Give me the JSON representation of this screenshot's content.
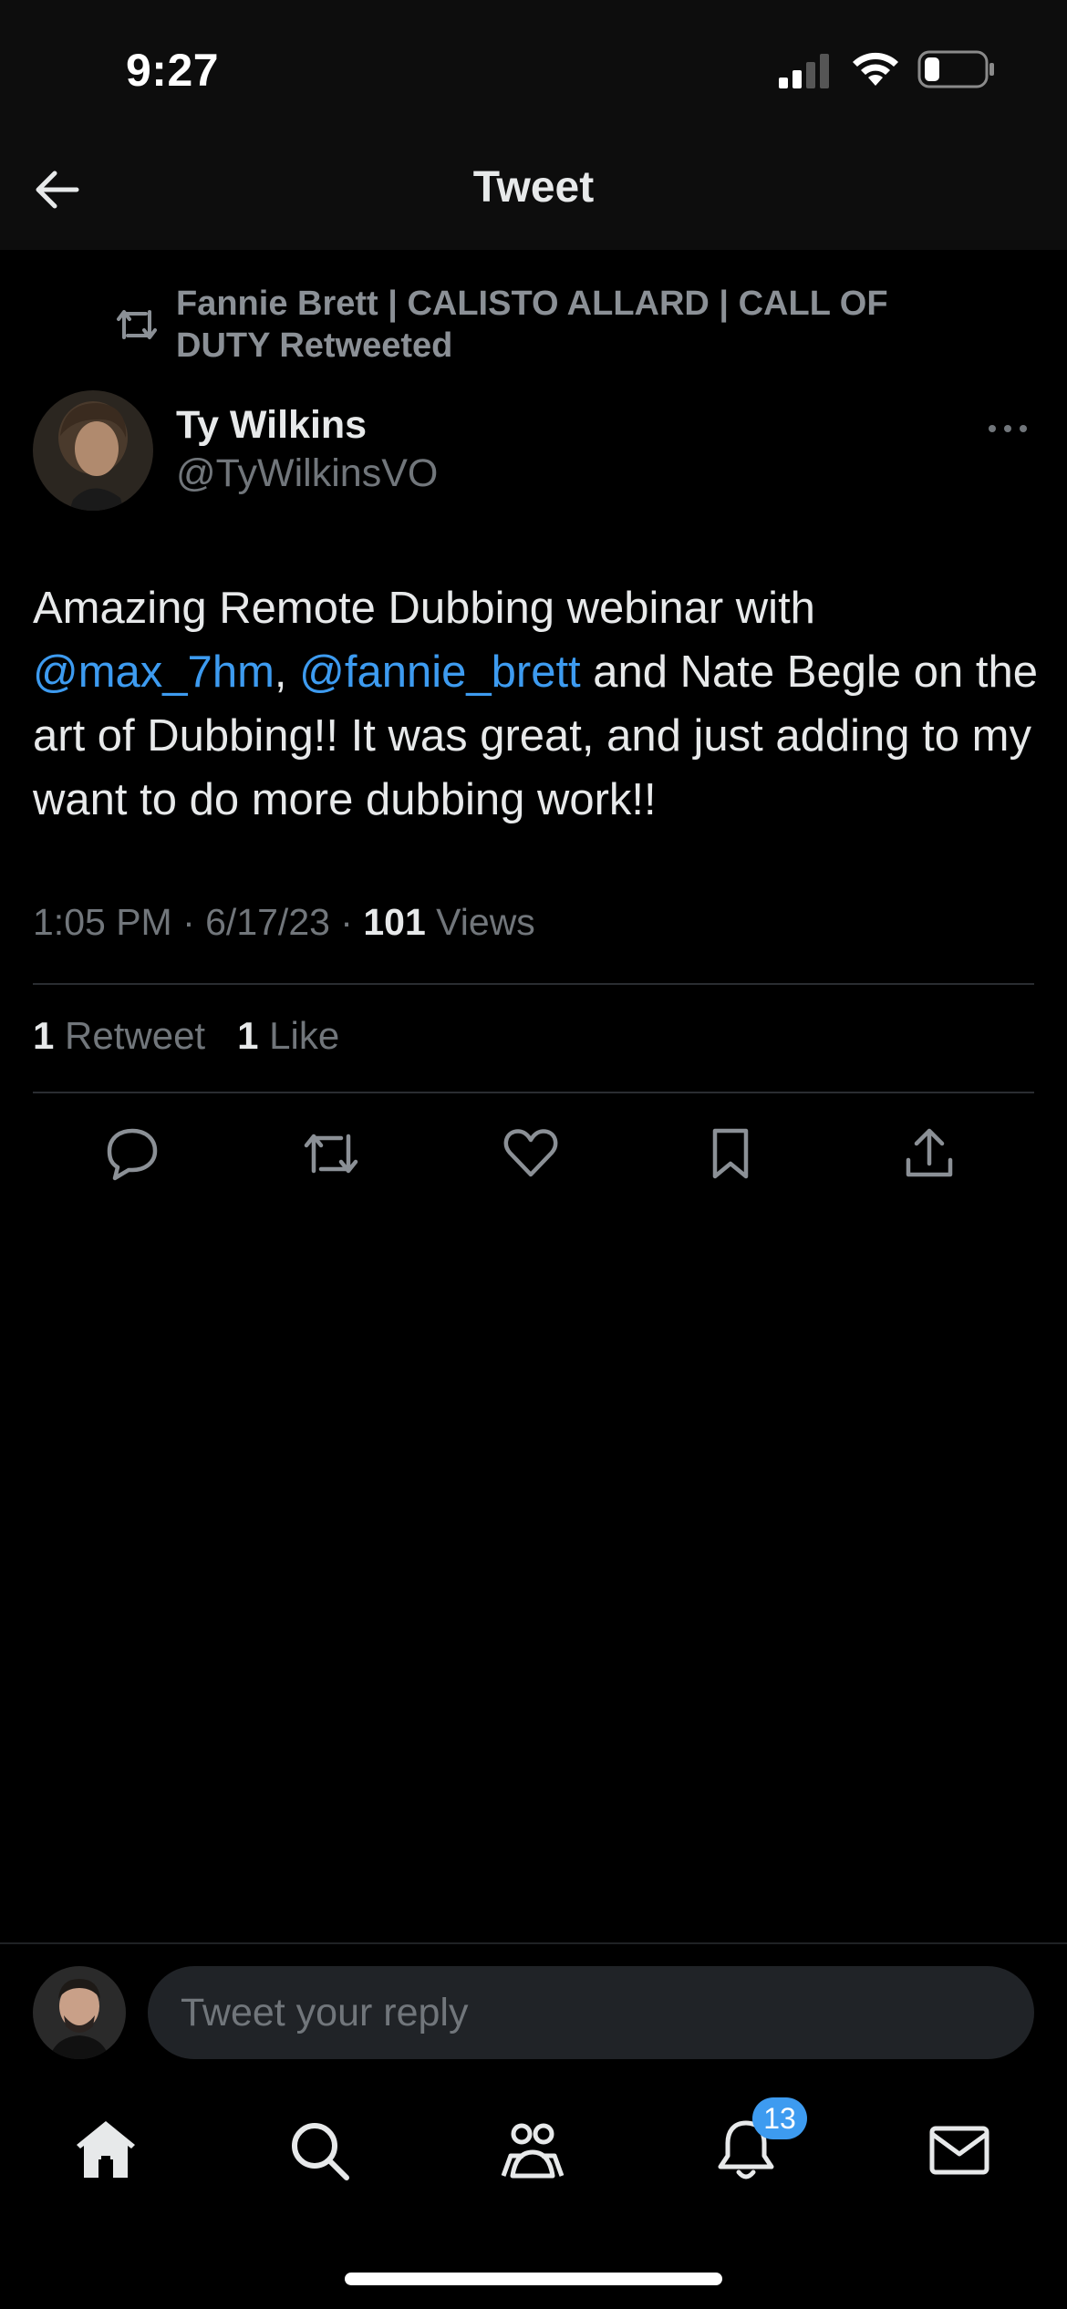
{
  "status_bar": {
    "time": "9:27",
    "signal_icon": "cellular-signal-icon",
    "wifi_icon": "wifi-icon",
    "battery_icon": "battery-icon",
    "battery_level": 0.2
  },
  "header": {
    "back_icon": "arrow-left-icon",
    "title": "Tweet"
  },
  "tweet": {
    "retweet_context": "Fannie Brett | CALISTO ALLARD | CALL OF DUTY Retweeted",
    "author_name": "Ty Wilkins",
    "author_handle": "@TyWilkinsVO",
    "more_icon": "more-horizontal-icon",
    "body": {
      "text_1": "Amazing Remote Dubbing webinar with ",
      "mention_1": "@max_7hm",
      "text_2": ", ",
      "mention_2": "@fannie_brett",
      "text_3": " and Nate Begle on the art of Dubbing!! It was great, and just adding to my want to do more dubbing work!!"
    },
    "timestamp": "1:05 PM · 6/17/23 · ",
    "views_count": "101",
    "views_label": " Views",
    "retweet_count": "1",
    "retweet_label": " Retweet",
    "like_count": "1",
    "like_label": " Like"
  },
  "actions": [
    "reply-icon",
    "retweet-icon",
    "like-icon",
    "bookmark-icon",
    "share-icon"
  ],
  "reply": {
    "placeholder": "Tweet your reply"
  },
  "nav": {
    "items": [
      "home-icon",
      "search-icon",
      "communities-icon",
      "notifications-icon",
      "messages-icon"
    ],
    "notification_badge": "13"
  },
  "colors": {
    "background": "#000000",
    "accent": "#3d9bf0",
    "secondary_text": "#71767b"
  }
}
